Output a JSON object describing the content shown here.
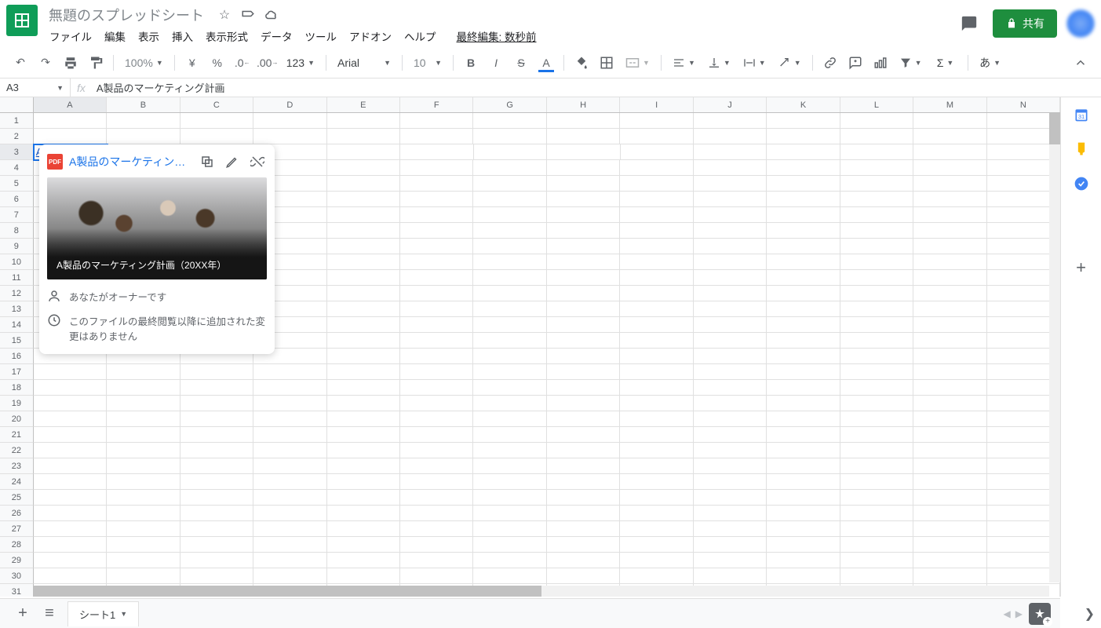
{
  "header": {
    "doc_title": "無題のスプレッドシート",
    "last_edit": "最終編集: 数秒前",
    "share_label": "共有"
  },
  "menubar": [
    "ファイル",
    "編集",
    "表示",
    "挿入",
    "表示形式",
    "データ",
    "ツール",
    "アドオン",
    "ヘルプ"
  ],
  "toolbar": {
    "zoom": "100%",
    "currency": "¥",
    "percent": "%",
    "dec_less": ".0",
    "dec_more": ".00",
    "fmt": "123",
    "font": "Arial",
    "size": "10",
    "ime": "あ"
  },
  "namebox": {
    "ref": "A3",
    "formula": "A製品のマーケティング計画"
  },
  "columns": [
    "A",
    "B",
    "C",
    "D",
    "E",
    "F",
    "G",
    "H",
    "I",
    "J",
    "K",
    "L",
    "M",
    "N"
  ],
  "rows": 31,
  "active_cell": {
    "row": 3,
    "col": 0,
    "text": "A製品のマーケティング計画"
  },
  "hover_card": {
    "pdf_label": "PDF",
    "title": "A製品のマーケティング計…",
    "img_caption": "A製品のマーケティング計画（20XX年）",
    "owner": "あなたがオーナーです",
    "changes": "このファイルの最終閲覧以降に追加された変更はありません"
  },
  "sheet_tabs": {
    "tab1": "シート1"
  }
}
